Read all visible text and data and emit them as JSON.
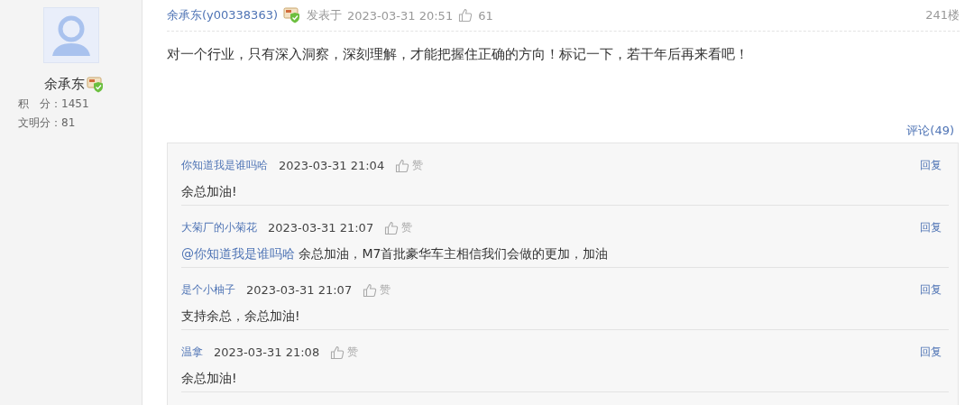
{
  "author": {
    "name": "余承东",
    "points_label": "积　分：",
    "points": "1451",
    "civility_label": "文明分：",
    "civility": "81"
  },
  "post": {
    "author": "余承东(y00338363)",
    "posted_label": "发表于",
    "time": "2023-03-31 20:51",
    "likes": "61",
    "floor": "241楼",
    "body": "对一个行业，只有深入洞察，深刻理解，才能把握住正确的方向！标记一下，若干年后再来看吧！",
    "comments_link": "评论(49)"
  },
  "comments": [
    {
      "user": "你知道我是谁吗哈",
      "time": "2023-03-31 21:04",
      "like": "赞",
      "reply": "回复",
      "text": "余总加油!"
    },
    {
      "user": "大菊厂的小菊花",
      "time": "2023-03-31 21:07",
      "like": "赞",
      "reply": "回复",
      "mention": "@你知道我是谁吗哈",
      "text": "余总加油，M7首批豪华车主相信我们会做的更加，加油"
    },
    {
      "user": "是个小柚子",
      "time": "2023-03-31 21:07",
      "like": "赞",
      "reply": "回复",
      "text": "支持余总，余总加油!"
    },
    {
      "user": "温拿",
      "time": "2023-03-31 21:08",
      "like": "赞",
      "reply": "回复",
      "text": "余总加油!"
    }
  ]
}
